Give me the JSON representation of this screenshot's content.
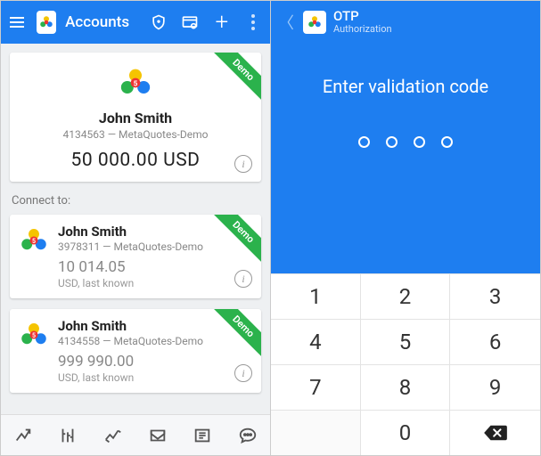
{
  "left": {
    "appbar": {
      "title": "Accounts"
    },
    "main_account": {
      "demo_label": "Demo",
      "name": "John Smith",
      "sub": "4134563 — MetaQuotes-Demo",
      "balance": "50 000.00 USD"
    },
    "connect_label": "Connect to:",
    "accounts": [
      {
        "demo_label": "Demo",
        "name": "John Smith",
        "sub": "3978311 — MetaQuotes-Demo",
        "balance": "10 014.05",
        "note": "USD, last known"
      },
      {
        "demo_label": "Demo",
        "name": "John Smith",
        "sub": "4134558 — MetaQuotes-Demo",
        "balance": "999 990.00",
        "note": "USD, last known"
      }
    ]
  },
  "right": {
    "appbar": {
      "title": "OTP",
      "subtitle": "Authorization"
    },
    "prompt": "Enter validation code",
    "keys": [
      "1",
      "2",
      "3",
      "4",
      "5",
      "6",
      "7",
      "8",
      "9",
      "",
      "0",
      "⌫"
    ]
  }
}
